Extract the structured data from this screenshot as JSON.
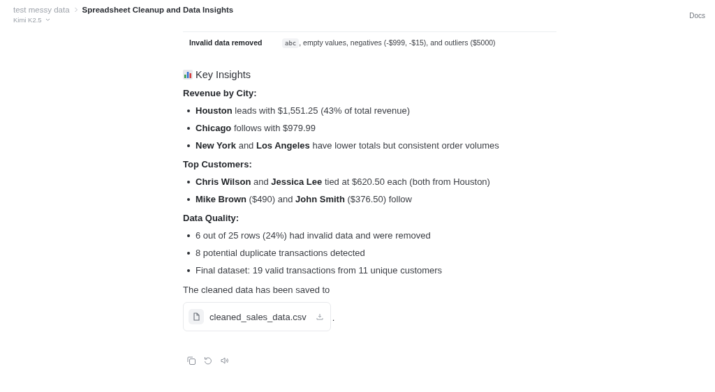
{
  "header": {
    "breadcrumb": "test messy data",
    "title": "Spreadsheet Cleanup and Data Insights",
    "model": "Kimi K2.5",
    "docs": "Docs"
  },
  "table_row": {
    "label": "Invalid data removed",
    "code": "abc",
    "text": ", empty values, negatives (-$999, -$15), and outliers ($5000)"
  },
  "insights_title": "Key Insights",
  "sections": [
    {
      "heading": "Revenue by City:",
      "bullets": [
        "**Houston** leads with $1,551.25 (43% of total revenue)",
        "**Chicago** follows with $979.99",
        "**New York** and **Los Angeles** have lower totals but consistent order volumes"
      ]
    },
    {
      "heading": "Top Customers:",
      "bullets": [
        "**Chris Wilson** and **Jessica Lee** tied at $620.50 each (both from Houston)",
        "**Mike Brown** ($490) and **John Smith** ($376.50) follow"
      ]
    },
    {
      "heading": "Data Quality:",
      "bullets": [
        "6 out of 25 rows (24%) had invalid data and were removed",
        "8 potential duplicate transactions detected",
        "Final dataset: 19 valid transactions from 11 unique customers"
      ]
    }
  ],
  "saved_note": "The cleaned data has been saved to",
  "file": {
    "name": "cleaned_sales_data.csv",
    "trailing": "."
  }
}
